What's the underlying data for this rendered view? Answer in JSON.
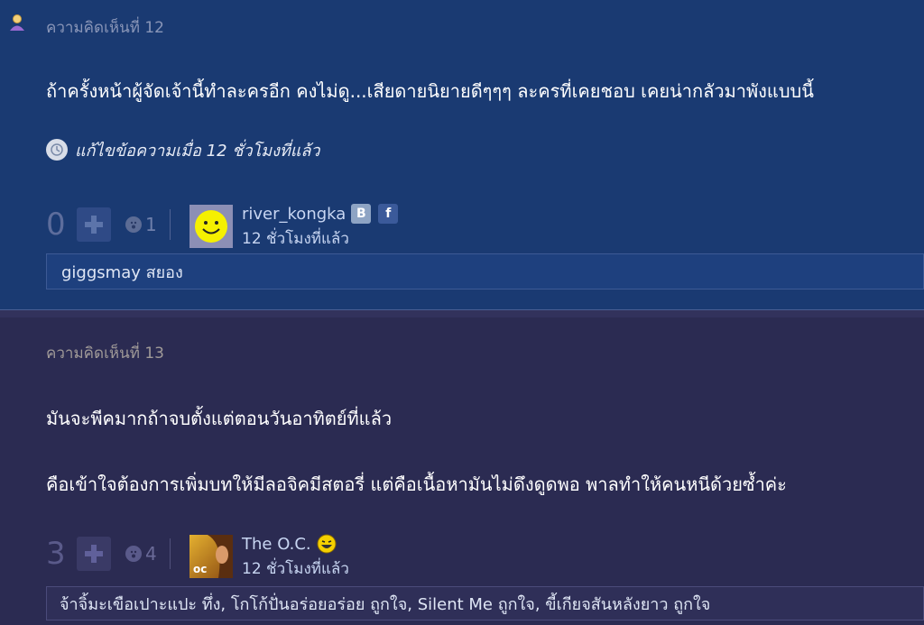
{
  "comments": [
    {
      "label": "ความคิดเห็นที่ 12",
      "paragraphs": [
        "ถ้าครั้งหน้าผู้จัดเจ้านี้ทำละครอีก คงไม่ดู...เสียดายนิยายดีๆๆๆ ละครที่เคยชอบ เคยน่ากลัวมาพังแบบนี้"
      ],
      "edit_note": "แก้ไขข้อความเมื่อ 12 ชั่วโมงที่แล้ว",
      "score": "0",
      "emotion_count": "1",
      "user": {
        "name": "river_kongka",
        "time": "12 ชั่วโมงที่แล้ว",
        "avatar": "smiley-avatar",
        "icons": [
          "blog-icon",
          "facebook-icon"
        ]
      },
      "reactions": "giggsmay สยอง"
    },
    {
      "label": "ความคิดเห็นที่ 13",
      "paragraphs": [
        "มันจะพีคมากถ้าจบตั้งแต่ตอนวันอาทิตย์ที่แล้ว",
        "คือเข้าใจต้องการเพิ่มบทให้มีลอจิคมีสตอรี่ แต่คือเนื้อหามันไม่ดึงดูดพอ พาลทำให้คนหนีด้วยซ้ำค่ะ"
      ],
      "score": "3",
      "emotion_count": "4",
      "user": {
        "name": "The O.C.",
        "time": "12 ชั่วโมงที่แล้ว",
        "avatar": "photo-avatar",
        "avatar_text": "oc",
        "icons": [
          "laugh-emoji-icon"
        ]
      },
      "reactions": "จ้าจิ้มะเขือเปาะแปะ ทึ่ง, โกโก้ปั่นอร่อยอร่อย ถูกใจ, Silent Me ถูกใจ, ขี้เกียจสันหลังยาว ถูกใจ"
    }
  ],
  "colors": {
    "panel_1": "#1a3a72",
    "panel_2": "#2b2b52",
    "text": "#ffffff",
    "muted": "#8a96b8"
  }
}
